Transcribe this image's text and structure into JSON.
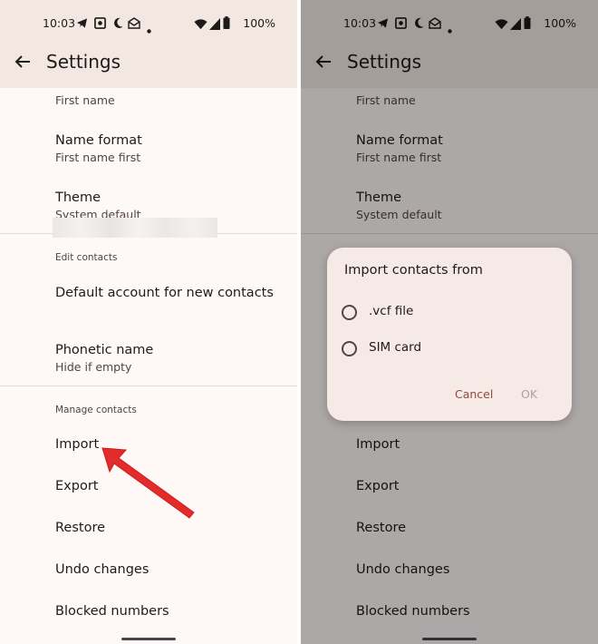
{
  "status": {
    "time": "10:03",
    "battery": "100%"
  },
  "appbar": {
    "title": "Settings"
  },
  "colors": {
    "accent": "#904a42",
    "arrow": "#e32b2b",
    "surface": "#fef8f7",
    "dialog": "#f5eae6"
  },
  "settings": {
    "partial_item_secondary": "First name",
    "name_format": {
      "label": "Name format",
      "value": "First name first"
    },
    "theme": {
      "label": "Theme",
      "value": "System default"
    },
    "edit_contacts": {
      "header": "Edit contacts",
      "default_account": "Default account for new contacts",
      "phonetic": {
        "label": "Phonetic name",
        "value": "Hide if empty"
      }
    },
    "manage_contacts": {
      "header": "Manage contacts",
      "items": [
        "Import",
        "Export",
        "Restore",
        "Undo changes",
        "Blocked numbers"
      ]
    }
  },
  "dialog": {
    "title": "Import contacts from",
    "options": [
      ".vcf file",
      "SIM card"
    ],
    "cancel": "Cancel",
    "ok": "OK"
  }
}
